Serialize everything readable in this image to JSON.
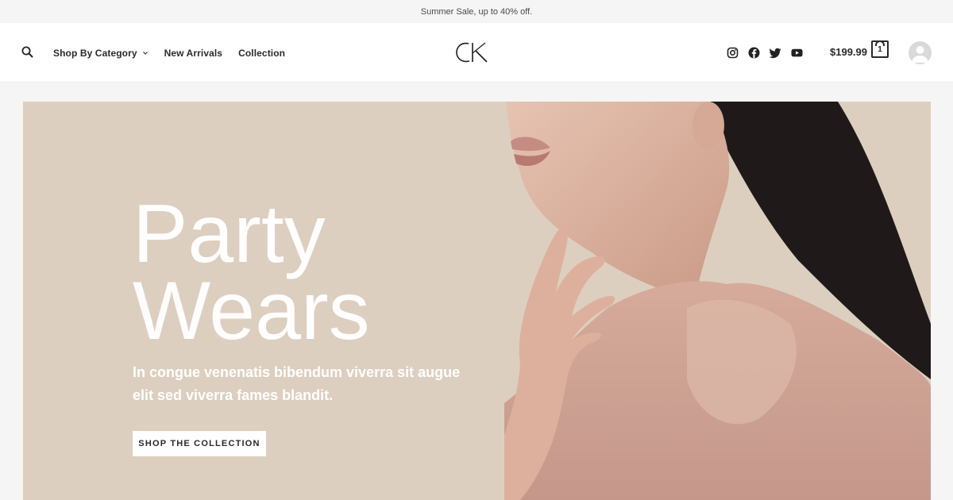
{
  "announcement": "Summer Sale, up to 40% off.",
  "nav": {
    "items": [
      {
        "label": "Shop By Category",
        "has_dropdown": true
      },
      {
        "label": "New Arrivals",
        "has_dropdown": false
      },
      {
        "label": "Collection",
        "has_dropdown": false
      }
    ]
  },
  "logo": {
    "text": "CK"
  },
  "social": [
    "instagram-icon",
    "facebook-icon",
    "twitter-icon",
    "youtube-icon"
  ],
  "cart": {
    "total": "$199.99",
    "count": "1"
  },
  "hero": {
    "title_line1": "Party",
    "title_line2": "Wears",
    "subtitle": "In congue venenatis bibendum viverra sit augue elit sed viverra fames blandit.",
    "cta": "SHOP THE COLLECTION",
    "background": "#ddcfbf"
  }
}
